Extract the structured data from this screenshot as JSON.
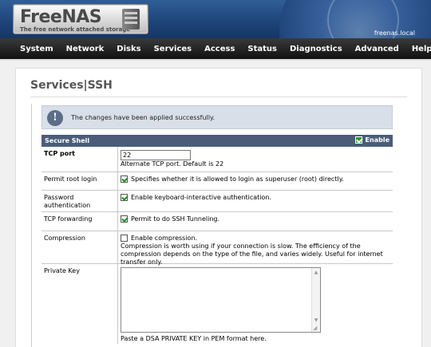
{
  "header": {
    "logo_title": "FreeNAS",
    "logo_subtitle": "The free network attached storage",
    "hostname": "freenas.local"
  },
  "nav": {
    "items": [
      "System",
      "Network",
      "Disks",
      "Services",
      "Access",
      "Status",
      "Diagnostics",
      "Advanced",
      "Help"
    ]
  },
  "page": {
    "title": "Services|SSH"
  },
  "info": {
    "message": "The changes have been applied successfully."
  },
  "section": {
    "title": "Secure Shell",
    "enable_label": "Enable",
    "enable_checked": true
  },
  "fields": {
    "tcp_port": {
      "label": "TCP port",
      "value": "22",
      "help": "Alternate TCP port. Default is 22"
    },
    "permit_root": {
      "label": "Permit root login",
      "checked": true,
      "text": "Specifies whether it is allowed to login as superuser (root) directly."
    },
    "password_auth": {
      "label": "Password authentication",
      "checked": true,
      "text": "Enable keyboard-interactive authentication."
    },
    "tcp_forwarding": {
      "label": "TCP forwarding",
      "checked": true,
      "text": "Permit to do SSH Tunneling."
    },
    "compression": {
      "label": "Compression",
      "checked": false,
      "text": "Enable compression.",
      "help": "Compression is worth using if your connection is slow. The efficiency of the compression depends on the type of the file, and varies widely. Useful for internet transfer only."
    },
    "private_key": {
      "label": "Private Key",
      "value": "",
      "help": "Paste a DSA PRIVATE KEY in PEM format here."
    }
  }
}
